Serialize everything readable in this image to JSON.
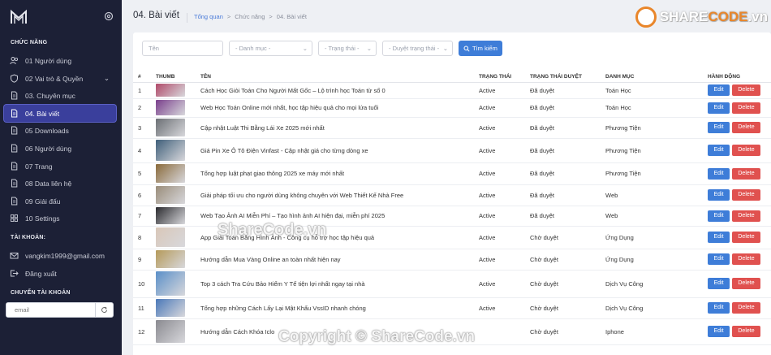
{
  "sidebar": {
    "section_function": "CHỨC NĂNG",
    "items": [
      {
        "label": "01 Người dùng",
        "icon": "users-icon",
        "active": false
      },
      {
        "label": "02 Vai trò & Quyền",
        "icon": "shield-icon",
        "active": false,
        "has_chevron": true
      },
      {
        "label": "03. Chuyên mục",
        "icon": "document-icon",
        "active": false
      },
      {
        "label": "04. Bài viết",
        "icon": "document-icon",
        "active": true
      },
      {
        "label": "05 Downloads",
        "icon": "document-icon",
        "active": false
      },
      {
        "label": "06 Người dùng",
        "icon": "document-icon",
        "active": false
      },
      {
        "label": "07 Trang",
        "icon": "document-icon",
        "active": false
      },
      {
        "label": "08 Data liên hệ",
        "icon": "document-icon",
        "active": false
      },
      {
        "label": "09 Giải đấu",
        "icon": "document-icon",
        "active": false
      },
      {
        "label": "10 Settings",
        "icon": "grid-icon",
        "active": false
      }
    ],
    "section_account": "TÀI KHOẢN:",
    "account_email": "vangkim1999@gmail.com",
    "logout_label": "Đăng xuất",
    "section_switch": "CHUYỂN TÀI KHOẢN",
    "switch_placeholder": "email"
  },
  "header": {
    "page_title": "04. Bài viết",
    "breadcrumb": [
      "Tổng quan",
      "Chức năng",
      "04. Bài viết"
    ],
    "breadcrumb_sep": ">"
  },
  "brand": {
    "share": "SHARE",
    "code": "CODE",
    "domain": ".vn"
  },
  "filters": {
    "name_placeholder": "Tên",
    "category": "- Danh mục -",
    "status": "- Trạng thái -",
    "approval": "- Duyệt trạng thái -",
    "search_label": "Tìm kiếm"
  },
  "table": {
    "headers": [
      "#",
      "THUMB",
      "TÊN",
      "TRẠNG THÁI",
      "TRẠNG THÁI DUYỆT",
      "DANH MỤC",
      "HÀNH ĐỘNG"
    ],
    "edit_label": "Edit",
    "delete_label": "Delete",
    "rows": [
      {
        "num": "1",
        "name": "Cách Học Giỏi Toán Cho Người Mất Gốc – Lộ trình học Toán từ số 0",
        "status": "Active",
        "approval": "Đã duyệt",
        "category": "Toán Học",
        "thumb_color": "#b04a6a"
      },
      {
        "num": "2",
        "name": "Web Học Toán Online mới nhất, học tập hiệu quả cho mọi lứa tuổi",
        "status": "Active",
        "approval": "Đã duyệt",
        "category": "Toán Học",
        "thumb_color": "#7a3f8c"
      },
      {
        "num": "3",
        "name": "Cập nhật Luật Thi Bằng Lái Xe 2025 mới nhất",
        "status": "Active",
        "approval": "Đã duyệt",
        "category": "Phương Tiện",
        "thumb_color": "#6b6f74"
      },
      {
        "num": "4",
        "name": "Giá Pin Xe Ô Tô Điện Vinfast - Cập nhật giá cho từng dòng xe",
        "status": "Active",
        "approval": "Đã duyệt",
        "category": "Phương Tiện",
        "thumb_color": "#3f5f7a"
      },
      {
        "num": "5",
        "name": "Tổng hợp luật phạt giao thông 2025 xe máy mới nhất",
        "status": "Active",
        "approval": "Đã duyệt",
        "category": "Phương Tiện",
        "thumb_color": "#8a6a3a"
      },
      {
        "num": "6",
        "name": "Giải pháp tối ưu cho người dùng không chuyên với Web Thiết Kế Nhà Free",
        "status": "Active",
        "approval": "Đã duyệt",
        "category": "Web",
        "thumb_color": "#9a8d7a"
      },
      {
        "num": "7",
        "name": "Web Tạo Ảnh AI Miễn Phí – Tạo hình ảnh AI hiện đại, miễn phí 2025",
        "status": "Active",
        "approval": "Đã duyệt",
        "category": "Web",
        "thumb_color": "#2a2a2e"
      },
      {
        "num": "8",
        "name": "App Giải Toán Bằng Hình Ảnh - Công cụ hỗ trợ học tập hiệu quả",
        "status": "Active",
        "approval": "Chờ duyệt",
        "category": "Ứng Dụng",
        "thumb_color": "#d9c7b8"
      },
      {
        "num": "9",
        "name": "Hướng dẫn Mua Vàng Online an toàn nhất hiện nay",
        "status": "Active",
        "approval": "Chờ duyệt",
        "category": "Ứng Dụng",
        "thumb_color": "#b59a5a"
      },
      {
        "num": "10",
        "name": "Top 3 cách Tra Cứu Bảo Hiểm Y Tế tiện lợi nhất ngay tại nhà",
        "status": "Active",
        "approval": "Chờ duyệt",
        "category": "Dịch Vụ Công",
        "thumb_color": "#5a8fc8"
      },
      {
        "num": "11",
        "name": "Tổng hợp những Cách Lấy Lại Mật Khẩu VssID nhanh chóng",
        "status": "Active",
        "approval": "Chờ duyệt",
        "category": "Dịch Vụ Công",
        "thumb_color": "#4a78b8"
      },
      {
        "num": "12",
        "name": "Hướng dẫn Cách Khóa Iclo",
        "status": "",
        "approval": "Chờ duyệt",
        "category": "Iphone",
        "thumb_color": "#8a8a90"
      }
    ]
  },
  "watermarks": {
    "center": "ShareCode.vn",
    "footer": "Copyright © ShareCode.vn"
  }
}
